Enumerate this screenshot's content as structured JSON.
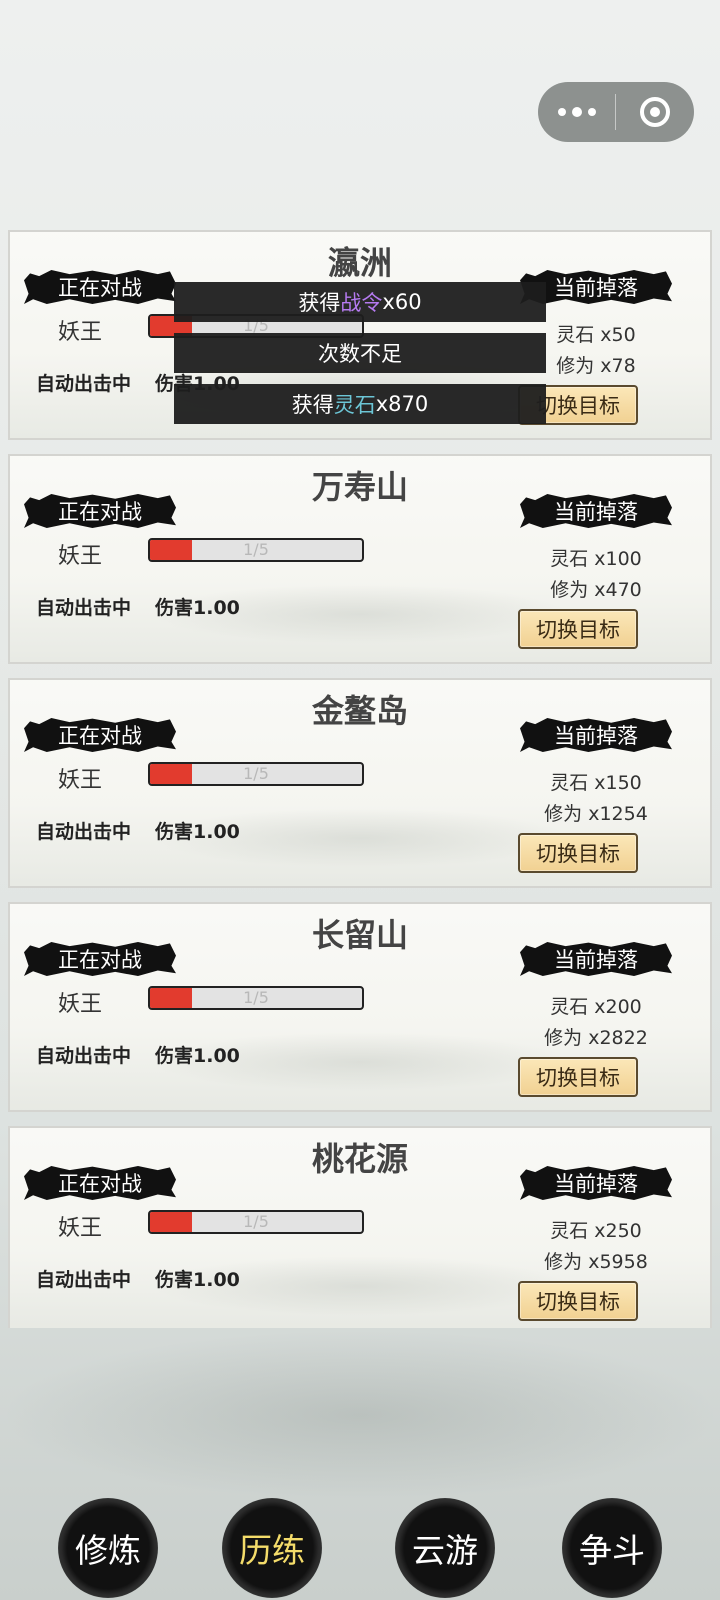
{
  "capsule": {
    "more_icon": "more-dots-icon",
    "close_icon": "target-circle-icon"
  },
  "labels": {
    "fighting": "正在对战",
    "drop": "当前掉落",
    "boss": "妖王",
    "auto": "自动出击中",
    "damage": "伤害1.00",
    "switch": "切换目标"
  },
  "cards": [
    {
      "title": "瀛洲",
      "hp_text": "1/5",
      "hp_fraction": 0.2,
      "drop1": "灵石 x50",
      "drop2": "修为 x78"
    },
    {
      "title": "万寿山",
      "hp_text": "1/5",
      "hp_fraction": 0.2,
      "drop1": "灵石 x100",
      "drop2": "修为 x470"
    },
    {
      "title": "金鳌岛",
      "hp_text": "1/5",
      "hp_fraction": 0.2,
      "drop1": "灵石 x150",
      "drop2": "修为 x1254"
    },
    {
      "title": "长留山",
      "hp_text": "1/5",
      "hp_fraction": 0.2,
      "drop1": "灵石 x200",
      "drop2": "修为 x2822"
    },
    {
      "title": "桃花源",
      "hp_text": "1/5",
      "hp_fraction": 0.2,
      "drop1": "灵石 x250",
      "drop2": "修为 x5958"
    }
  ],
  "toasts": {
    "t1_prefix": "获得 ",
    "t1_item": "战令",
    "t1_suffix": "x60",
    "t2": "次数不足",
    "t3_prefix": "获得 ",
    "t3_item": "灵石",
    "t3_suffix": "x870"
  },
  "nav": [
    {
      "label": "修炼",
      "active": false
    },
    {
      "label": "历练",
      "active": true
    },
    {
      "label": "云游",
      "active": false
    },
    {
      "label": "争斗",
      "active": false
    }
  ],
  "colors": {
    "hp_fill": "#e23b2e",
    "active_nav": "#f4dc6a",
    "toast_purple": "#b57af0",
    "toast_cyan": "#6cc6d6"
  }
}
